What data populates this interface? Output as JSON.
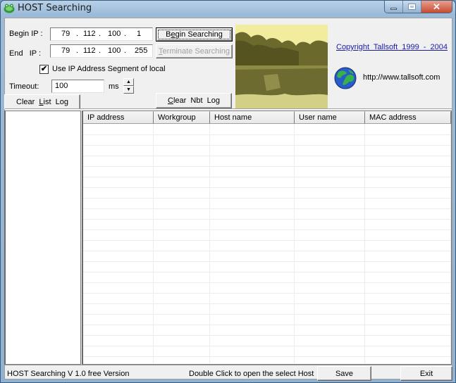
{
  "window": {
    "title": "HOST Searching",
    "app_icon": "frog-icon",
    "controls": {
      "minimize": "minimize-icon",
      "maximize": "maximize-icon",
      "close": "close-icon"
    }
  },
  "form": {
    "begin_ip_label": "Begin IP :",
    "end_ip_label": "End   IP :",
    "begin_ip": [
      "79",
      "112",
      "100",
      "1"
    ],
    "end_ip": [
      "79",
      "112",
      "100",
      "255"
    ],
    "ip_separator": ".",
    "use_local_segment": {
      "label": "Use IP Address Segment of local",
      "checked": true,
      "check_glyph": "✔"
    },
    "timeout_label": "Timeout:",
    "timeout_value": "100",
    "timeout_unit": "ms"
  },
  "buttons": {
    "begin_searching": {
      "pre": "B",
      "accel": "e",
      "post": "gin Searching"
    },
    "terminate_searching": {
      "accel": "T",
      "post": "erminate Searching",
      "disabled": true
    },
    "clear_list_log": {
      "pre": "Clear  ",
      "accel": "L",
      "post": "ist  Log"
    },
    "clear_nbt_log": {
      "accel": "C",
      "post": "lear  Nbt  Log"
    },
    "save": "Save",
    "exit": "Exit",
    "spin_up": "▲",
    "spin_down": "▼"
  },
  "about": {
    "copyright_link": "Copyright  Tallsoft  1999 - 2004",
    "website": "http://www.tallsoft.com",
    "globe_icon": "globe-icon"
  },
  "table": {
    "columns": [
      "IP address",
      "Workgroup",
      "Host name",
      "User name",
      "MAC address"
    ],
    "rows": []
  },
  "status": {
    "version": "HOST Searching V 1.0 free Version",
    "hint": "Double Click to open the select Host"
  }
}
